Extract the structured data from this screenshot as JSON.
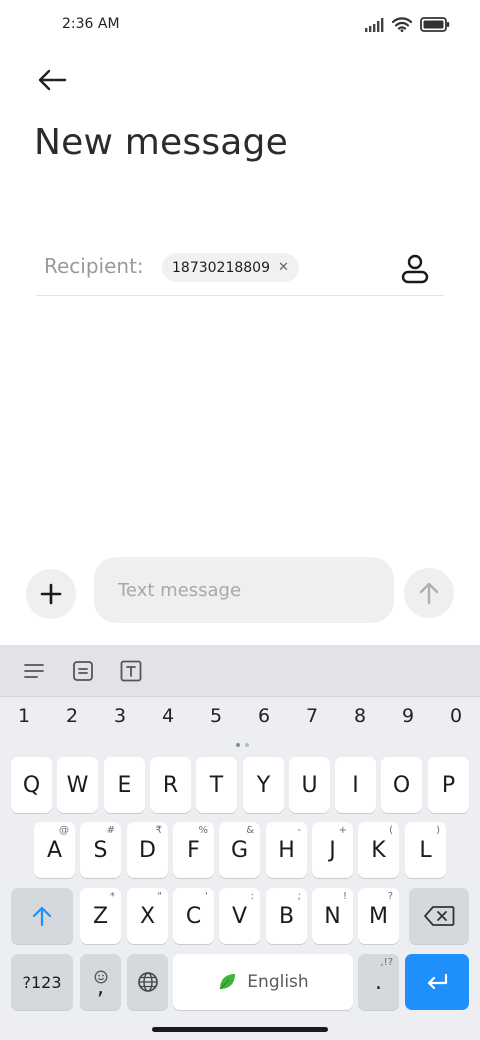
{
  "status_bar": {
    "time": "2:36 AM",
    "icons": [
      "signal-icon",
      "wifi-icon",
      "battery-icon"
    ]
  },
  "header": {
    "back_icon": "arrow-left-icon",
    "title": "New message"
  },
  "recipient": {
    "label": "Recipient:",
    "chips": [
      {
        "value": "18730218809",
        "remove_icon": "close-icon"
      }
    ],
    "contacts_icon": "person-icon"
  },
  "compose": {
    "attach_icon": "plus-icon",
    "placeholder": "Text message",
    "value": "",
    "send_icon": "arrow-up-icon"
  },
  "keyboard": {
    "toolbar_icons": [
      "menu-icon",
      "clipboard-icon",
      "text-format-icon"
    ],
    "numbers": [
      "1",
      "2",
      "3",
      "4",
      "5",
      "6",
      "7",
      "8",
      "9",
      "0"
    ],
    "row1": [
      {
        "label": "Q"
      },
      {
        "label": "W"
      },
      {
        "label": "E"
      },
      {
        "label": "R"
      },
      {
        "label": "T"
      },
      {
        "label": "Y"
      },
      {
        "label": "U"
      },
      {
        "label": "I"
      },
      {
        "label": "O"
      },
      {
        "label": "P"
      }
    ],
    "row2": [
      {
        "label": "A",
        "hint": "@"
      },
      {
        "label": "S",
        "hint": "#"
      },
      {
        "label": "D",
        "hint": "₹"
      },
      {
        "label": "F",
        "hint": "%"
      },
      {
        "label": "G",
        "hint": "&"
      },
      {
        "label": "H",
        "hint": "-"
      },
      {
        "label": "J",
        "hint": "+"
      },
      {
        "label": "K",
        "hint": "("
      },
      {
        "label": "L",
        "hint": ")"
      }
    ],
    "row3": [
      {
        "label": "Z",
        "hint": "*"
      },
      {
        "label": "X",
        "hint": "\""
      },
      {
        "label": "C",
        "hint": "'"
      },
      {
        "label": "V",
        "hint": ":"
      },
      {
        "label": "B",
        "hint": ";"
      },
      {
        "label": "N",
        "hint": "!"
      },
      {
        "label": "M",
        "hint": "?"
      }
    ],
    "shift_icon": "shift-arrow-icon",
    "backspace_icon": "backspace-icon",
    "symbols_label": "?123",
    "emoji_comma_label": ",",
    "emoji_icon": "emoji-icon",
    "globe_icon": "globe-icon",
    "space_label": "English",
    "space_icon": "leaf-icon",
    "period_label": ".",
    "period_hint": ",!?",
    "enter_icon": "enter-icon",
    "colors": {
      "enter": "#1f8ffb",
      "shift": "#1f8ffb",
      "leaf": "#3fb33a"
    }
  }
}
